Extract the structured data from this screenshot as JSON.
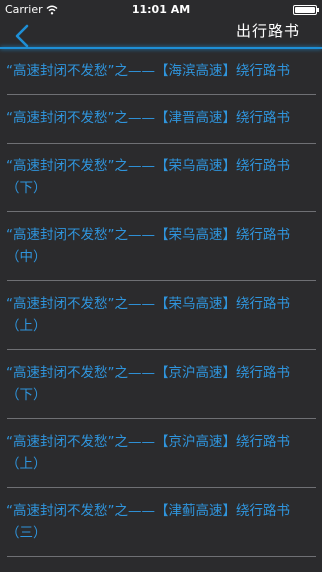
{
  "status_bar": {
    "carrier": "Carrier",
    "time": "11:01 AM",
    "battery_level": 1.0
  },
  "nav": {
    "back_icon": "chevron-left-icon",
    "title": "出行路书",
    "accent_color": "#1e8fd6"
  },
  "list": {
    "text_color": "#2f95dd",
    "items": [
      {
        "label": "“高速封闭不发愁”之——【海滨高速】绕行路书"
      },
      {
        "label": "“高速封闭不发愁”之——【津晋高速】绕行路书"
      },
      {
        "label": "“高速封闭不发愁”之——【荣乌高速】绕行路书（下）"
      },
      {
        "label": "“高速封闭不发愁”之——【荣乌高速】绕行路书（中）"
      },
      {
        "label": "“高速封闭不发愁”之——【荣乌高速】绕行路书（上）"
      },
      {
        "label": "“高速封闭不发愁”之——【京沪高速】绕行路书（下）"
      },
      {
        "label": "“高速封闭不发愁”之——【京沪高速】绕行路书（上）"
      },
      {
        "label": "“高速封闭不发愁”之——【津蓟高速】绕行路书（三）"
      }
    ]
  }
}
